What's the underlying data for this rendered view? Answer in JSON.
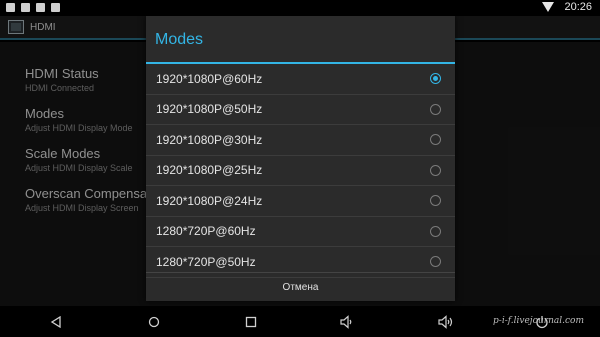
{
  "status_bar": {
    "time": "20:26",
    "left_icons": [
      "image-icon",
      "clipboard-icon",
      "clipboard-check-icon",
      "bag-icon"
    ],
    "right_icons": [
      "wifi-icon"
    ]
  },
  "action_bar": {
    "title": "HDMI",
    "icon": "hdmi-app-icon"
  },
  "settings": [
    {
      "title": "HDMI Status",
      "subtitle": "HDMI Connected"
    },
    {
      "title": "Modes",
      "subtitle": "Adjust HDMI Display Mode"
    },
    {
      "title": "Scale Modes",
      "subtitle": "Adjust HDMI Display Scale"
    },
    {
      "title": "Overscan Compensa",
      "subtitle": "Adjust HDMI Display Screen"
    }
  ],
  "dialog": {
    "title": "Modes",
    "options": [
      {
        "label": "1920*1080P@60Hz",
        "selected": true
      },
      {
        "label": "1920*1080P@50Hz",
        "selected": false
      },
      {
        "label": "1920*1080P@30Hz",
        "selected": false
      },
      {
        "label": "1920*1080P@25Hz",
        "selected": false
      },
      {
        "label": "1920*1080P@24Hz",
        "selected": false
      },
      {
        "label": "1280*720P@60Hz",
        "selected": false
      },
      {
        "label": "1280*720P@50Hz",
        "selected": false
      }
    ],
    "cancel_label": "Отмена"
  },
  "nav_bar": {
    "icons": [
      "back-icon",
      "home-icon",
      "recents-icon",
      "volume-down-icon",
      "volume-up-icon",
      "power-icon"
    ]
  },
  "watermark": "p-i-f.livejournal.com",
  "colors": {
    "accent": "#33b5e5",
    "dialog_bg": "#2b2b2b",
    "background": "#151515"
  }
}
